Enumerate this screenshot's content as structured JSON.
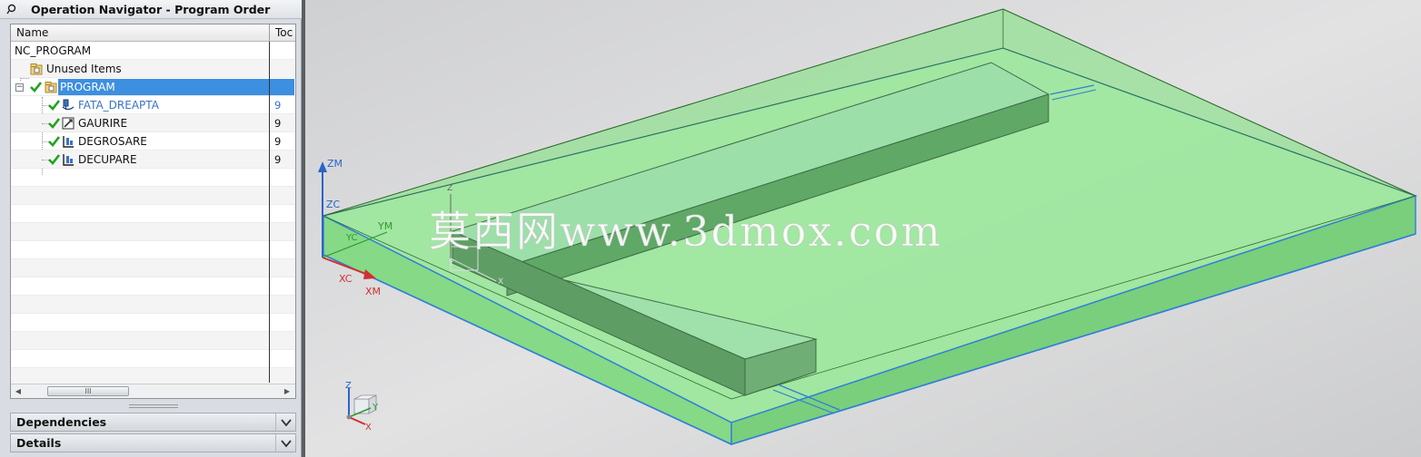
{
  "navigator": {
    "title": "Operation Navigator - Program Order",
    "columns": {
      "name": "Name",
      "tool": "Toc"
    },
    "rows": [
      {
        "label": "NC_PROGRAM",
        "tool": ""
      },
      {
        "label": "Unused Items",
        "tool": ""
      },
      {
        "label": "PROGRAM",
        "tool": ""
      },
      {
        "label": "FATA_DREAPTA",
        "tool": "9"
      },
      {
        "label": "GAURIRE",
        "tool": "9"
      },
      {
        "label": "DEGROSARE",
        "tool": "9"
      },
      {
        "label": "DECUPARE",
        "tool": "9"
      }
    ],
    "scroll_thumb_glyph": "III",
    "expander_glyph": "−"
  },
  "sections": {
    "dependencies": "Dependencies",
    "details": "Details"
  },
  "viewport": {
    "axes": {
      "zm": "ZM",
      "zc": "ZC",
      "ym": "YM",
      "yc": "YC",
      "xc": "XC",
      "xm": "XM",
      "wcs_z": "Z",
      "wcs_y": "Y",
      "wcs_x": "X",
      "triad_z": "Z",
      "triad_y": "Y",
      "triad_x": "X"
    },
    "watermark": "莫西网www.3dmox.com"
  },
  "colors": {
    "selection": "#3d8fe0",
    "stock_green": "#8ee88e",
    "stock_edge": "#2f7fd6",
    "part_green": "#5fa866",
    "check_green": "#23a123"
  }
}
